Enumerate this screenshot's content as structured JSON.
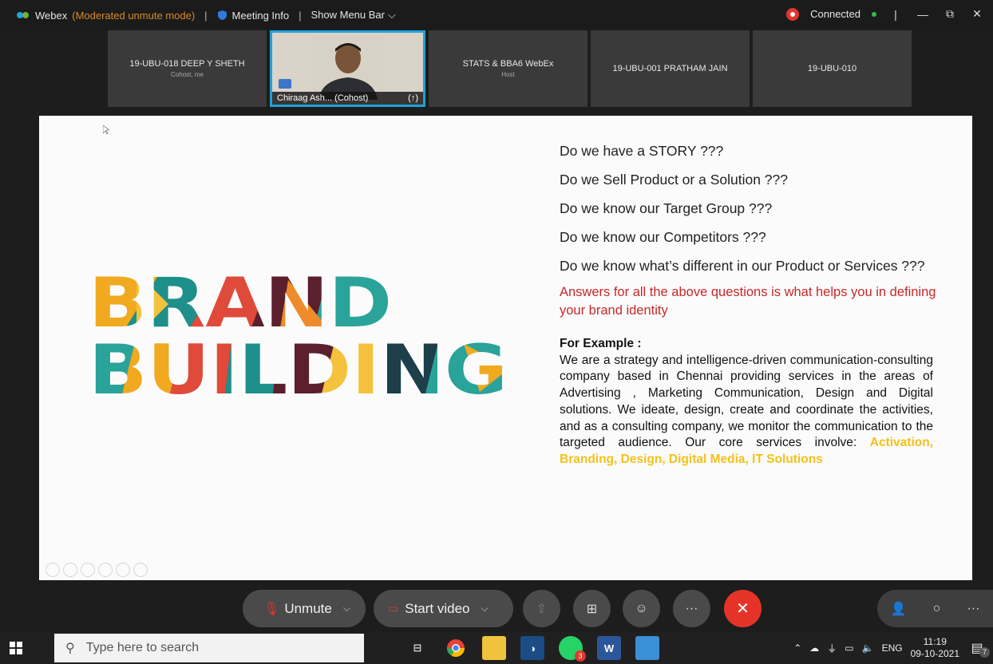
{
  "topbar": {
    "app": "Webex",
    "mode": "(Moderated unmute mode)",
    "meeting_info": "Meeting Info",
    "show_menu": "Show Menu Bar",
    "connection": "Connected"
  },
  "participants": [
    {
      "name": "19-UBU-018 DEEP Y SHETH",
      "role": "Cohost, me"
    },
    {
      "name": "Chiraag Ash... (Cohost)",
      "video": true
    },
    {
      "name": "STATS & BBA6 WebEx",
      "role": "Host"
    },
    {
      "name": "19-UBU-001 PRATHAM JAIN",
      "role": ""
    },
    {
      "name": "19-UBU-010",
      "role": ""
    }
  ],
  "slide": {
    "art_line1": "BRAND",
    "art_line2": "BUILDING",
    "questions": [
      "Do we have a STORY ???",
      "Do we Sell Product or a Solution ???",
      "Do we know our Target Group ???",
      "Do we know our Competitors ???",
      "Do we know what’s different in our Product or Services ???"
    ],
    "answer": "Answers for all the above questions is what helps you in defining your brand identity",
    "example_heading": "For Example :",
    "example_body": "We are a strategy and intelligence-driven communication-consulting company based in Chennai providing services in the areas of Advertising , Marketing Communication, Design and Digital solutions. We ideate, design, create and coordinate the activities, and as a consulting company, we monitor the communication to the targeted audience. Our core services involve: ",
    "example_highlight": "Activation, Branding, Design, Digital Media, IT Solutions"
  },
  "controls": {
    "unmute": "Unmute",
    "start_video": "Start video"
  },
  "taskbar": {
    "search_placeholder": "Type here to search",
    "lang": "ENG",
    "time": "11:19",
    "date": "09-10-2021",
    "notif_count": "7",
    "whatsapp_badge": "3"
  },
  "colors": {
    "accent": "#1ea2d8",
    "end_call": "#e6332a",
    "answer_red": "#c8282a",
    "highlight_yellow": "#f4c119"
  }
}
